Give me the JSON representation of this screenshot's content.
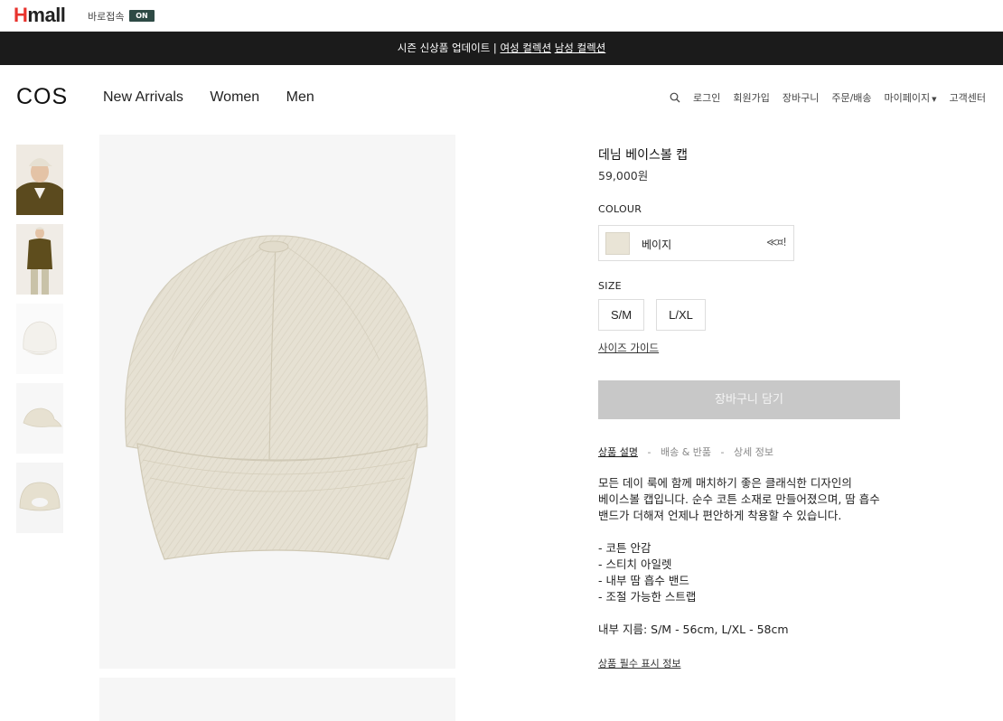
{
  "hmall": {
    "logo_h": "H",
    "logo_rest": "mall",
    "shortcut": "바로접속",
    "toggle": "ON",
    "brand_color": "#e8332d"
  },
  "promo": {
    "prefix": "시즌 신상품 업데이트 | ",
    "link1": "여성 컬렉션",
    "link2": "남성 컬렉션"
  },
  "header": {
    "logo": "COS",
    "nav": [
      "New Arrivals",
      "Women",
      "Men"
    ],
    "util": {
      "search_icon": "search-icon",
      "login": "로그인",
      "signup": "회원가입",
      "cart": "장바구니",
      "orders": "주문/배송",
      "mypage": "마이페이지",
      "support": "고객센터"
    }
  },
  "gallery": {
    "thumbnails": [
      "thumb-model-front",
      "thumb-model-full",
      "thumb-cap-white",
      "thumb-cap-side",
      "thumb-cap-back"
    ]
  },
  "product": {
    "name": "데님 베이스볼 캡",
    "price": "59,000원",
    "colour_label": "COLOUR",
    "colour_name": "베이지",
    "colour_note": "≪¤!",
    "swatch_color": "#e9e4d6",
    "size_label": "SIZE",
    "sizes": [
      "S/M",
      "L/XL"
    ],
    "size_guide": "사이즈 가이드",
    "add_to_cart": "장바구니 담기",
    "tabs": {
      "description": "상품 설명",
      "shipping": "배송 & 반품",
      "details": "상세 정보",
      "separator": "-"
    },
    "description": {
      "line1": "모든 데이 룩에 함께 매치하기 좋은 클래식한 디자인의",
      "line2": "베이스볼 캡입니다. 순수 코튼 소재로 만들어졌으며, 땀 흡수",
      "line3": "밴드가 더해져 언제나 편안하게 착용할 수 있습니다.",
      "bullets": [
        "- 코튼 안감",
        "- 스티치 아일렛",
        "- 내부 땀 흡수 밴드",
        "- 조절 가능한 스트랩"
      ],
      "size_note": "내부 지름: S/M - 56cm, L/XL - 58cm"
    },
    "required_info": "상품 필수 표시 정보"
  }
}
